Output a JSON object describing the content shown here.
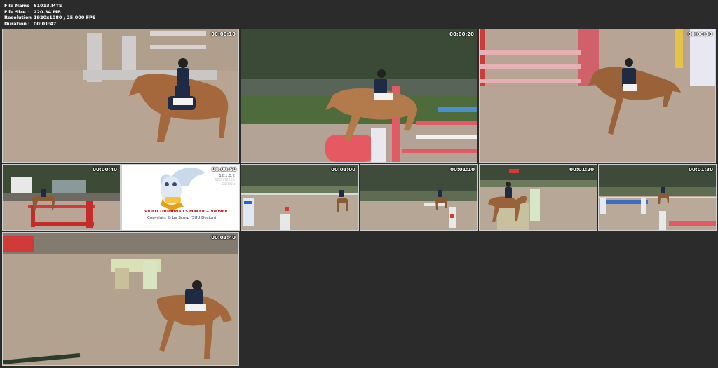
{
  "file_info": [
    {
      "label": "File Name",
      "value": "61013.MTS"
    },
    {
      "label": "File Size",
      "value": "220.34 MB"
    },
    {
      "label": "Resolution",
      "value": "1920x1080 / 25.000 FPS"
    },
    {
      "label": "Duration",
      "value": "00:01:47"
    }
  ],
  "separator": ":",
  "thumbnails": [
    {
      "timestamp": "00:00:10"
    },
    {
      "timestamp": "00:00:20"
    },
    {
      "timestamp": "00:00:30"
    },
    {
      "timestamp": "00:00:40"
    },
    {
      "timestamp": "00:00:50"
    },
    {
      "timestamp": "00:01:00"
    },
    {
      "timestamp": "00:01:10"
    },
    {
      "timestamp": "00:01:20"
    },
    {
      "timestamp": "00:01:30"
    },
    {
      "timestamp": "00:01:40"
    }
  ],
  "logo": {
    "title_part1": "VIDEO THUMBNAILS MAKER",
    "title_plus": "+",
    "title_part2": "VIEWER",
    "copyright": "Copyright @ by Scorp (SUU Design)",
    "version": "12.1.0.2",
    "edition_line1": "REGISTERED",
    "edition_line2": "EDITION"
  },
  "colors": {
    "background": "#2b2b2b",
    "arena_sand": "#b39f8e",
    "horse": "#a4683c",
    "jacket": "#1f2a44",
    "pole_red": "#d23a3a",
    "logo_blue": "#1a3fb0",
    "logo_red": "#c01616"
  }
}
